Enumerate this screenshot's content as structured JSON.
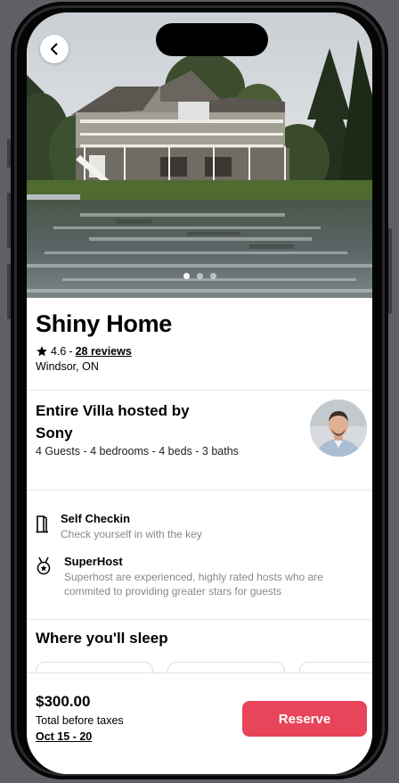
{
  "listing": {
    "title": "Shiny Home",
    "rating": "4.6",
    "separator": "-",
    "reviews": "28 reviews",
    "location": "Windsor, ON",
    "hero_image_count": 3,
    "hero_active_index": 0
  },
  "host": {
    "title": "Entire Villa hosted by Sony",
    "details": "4 Guests - 4 bedrooms - 4 beds - 3 baths"
  },
  "features": [
    {
      "icon": "door-icon",
      "title": "Self Checkin",
      "description": "Check yourself in with the key"
    },
    {
      "icon": "medal-icon",
      "title": "SuperHost",
      "description": "Superhost are experienced, highly rated hosts who are commited to providing greater stars for guests"
    }
  ],
  "sleep": {
    "heading": "Where you'll sleep"
  },
  "footer": {
    "price": "$300.00",
    "price_note": "Total before taxes",
    "dates": "Oct 15 - 20",
    "reserve_label": "Reserve"
  },
  "colors": {
    "accent": "#e8445a",
    "frame": "#050505"
  }
}
